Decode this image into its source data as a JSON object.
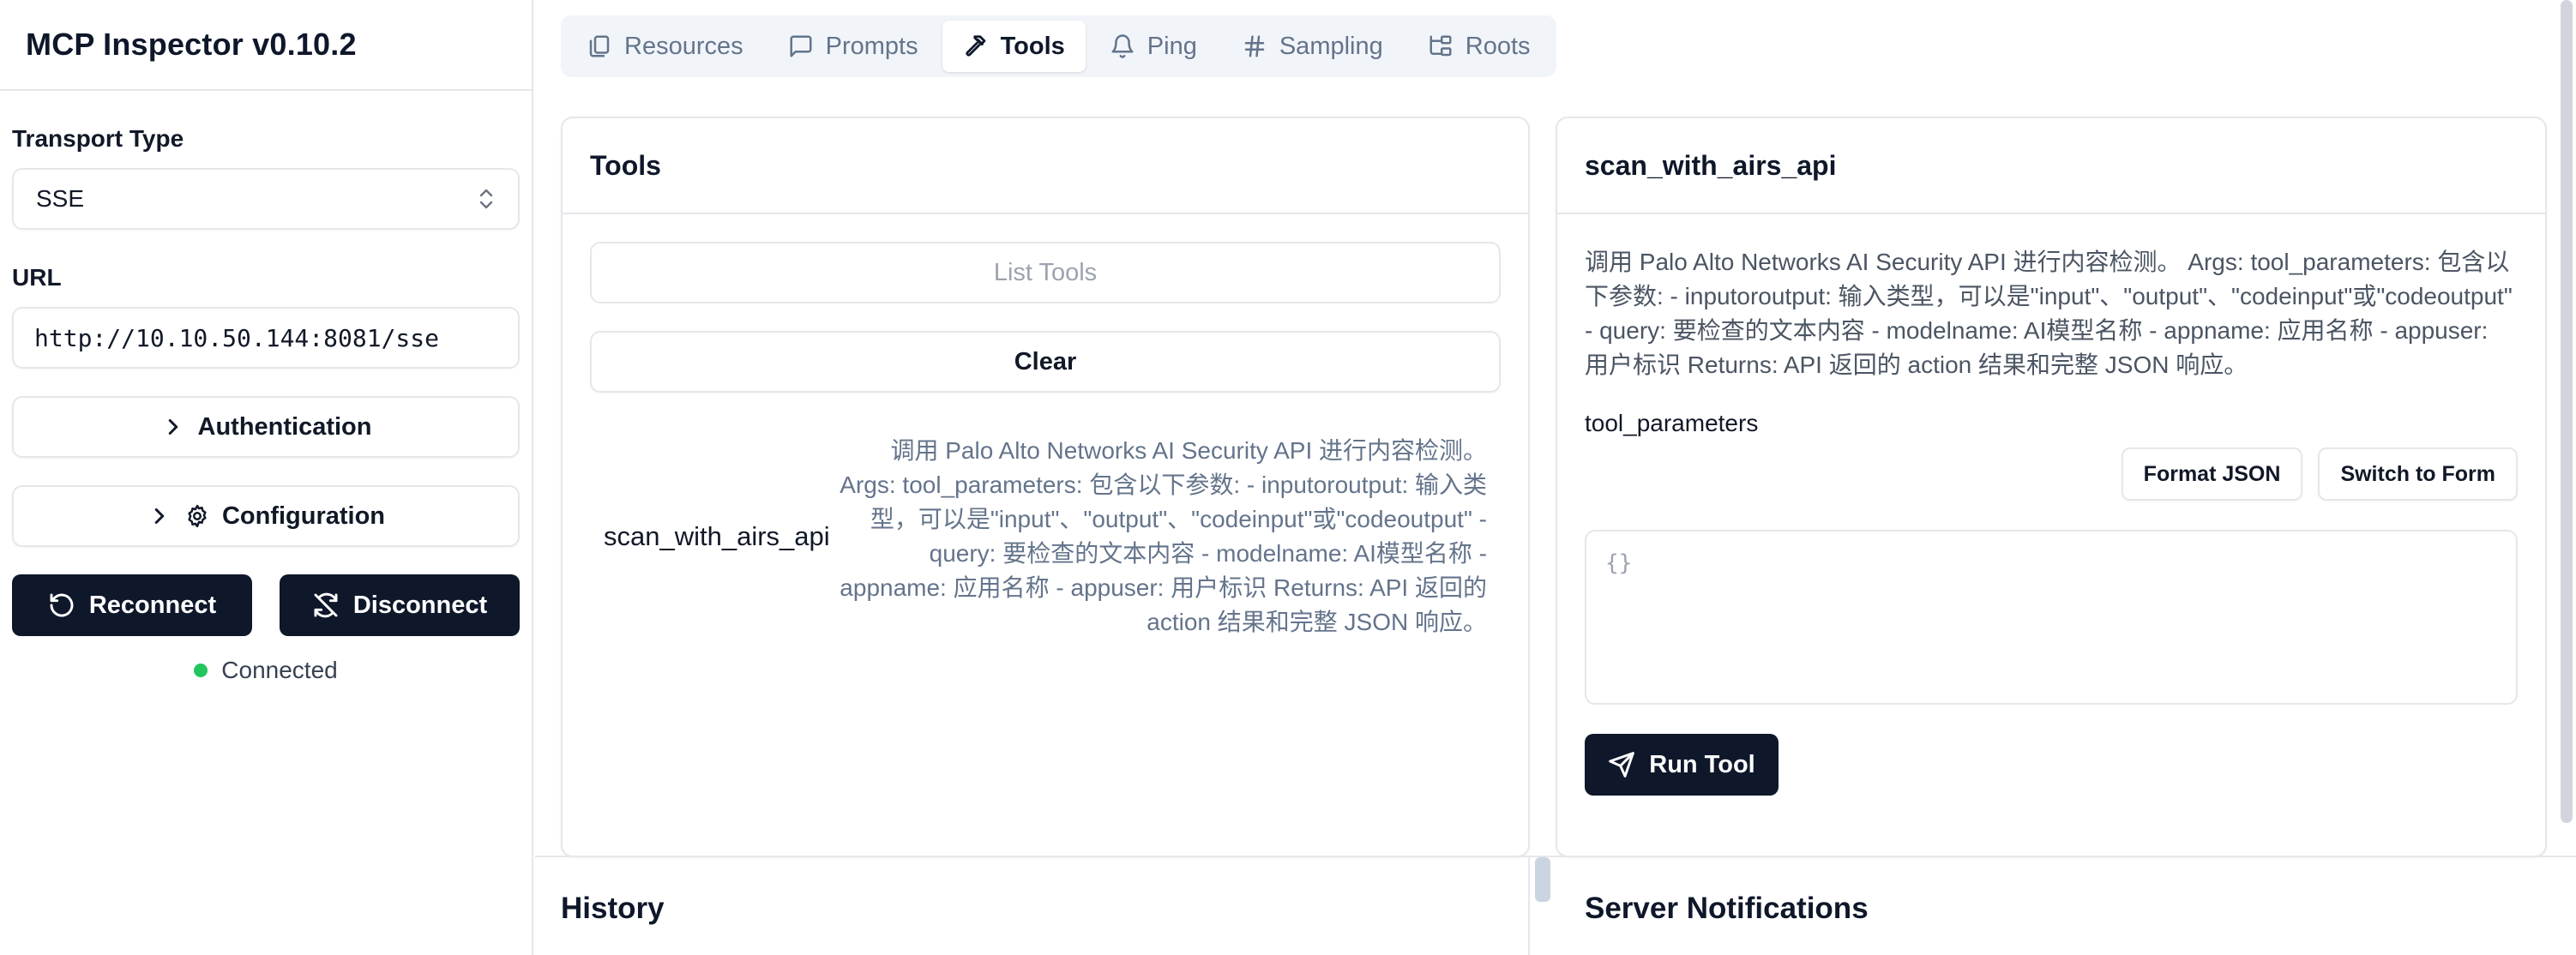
{
  "app": {
    "title": "MCP Inspector v0.10.2"
  },
  "sidebar": {
    "transport_label": "Transport Type",
    "transport_value": "SSE",
    "url_label": "URL",
    "url_value": "http://10.10.50.144:8081/sse",
    "authentication_label": "Authentication",
    "configuration_label": "Configuration",
    "reconnect_label": "Reconnect",
    "disconnect_label": "Disconnect",
    "status_text": "Connected",
    "status_color": "#22c55e"
  },
  "tabs": [
    {
      "label": "Resources",
      "icon": "files-icon"
    },
    {
      "label": "Prompts",
      "icon": "message-square-icon"
    },
    {
      "label": "Tools",
      "icon": "hammer-icon",
      "active": true
    },
    {
      "label": "Ping",
      "icon": "bell-icon"
    },
    {
      "label": "Sampling",
      "icon": "hash-icon"
    },
    {
      "label": "Roots",
      "icon": "folder-tree-icon"
    }
  ],
  "tools_panel": {
    "title": "Tools",
    "list_tools_label": "List Tools",
    "clear_label": "Clear",
    "items": [
      {
        "name": "scan_with_airs_api",
        "description": "调用 Palo Alto Networks AI Security API 进行内容检测。 Args: tool_parameters: 包含以下参数: - inputoroutput: 输入类型，可以是\"input\"、\"output\"、\"codeinput\"或\"codeoutput\" - query: 要检查的文本内容 - modelname: AI模型名称 - appname: 应用名称 - appuser: 用户标识 Returns: API 返回的 action 结果和完整 JSON 响应。"
      }
    ]
  },
  "detail_panel": {
    "title": "scan_with_airs_api",
    "description": "调用 Palo Alto Networks AI Security API 进行内容检测。 Args: tool_parameters: 包含以下参数: - inputoroutput: 输入类型，可以是\"input\"、\"output\"、\"codeinput\"或\"codeoutput\" - query: 要检查的文本内容 - modelname: AI模型名称 - appname: 应用名称 - appuser: 用户标识 Returns: API 返回的 action 结果和完整 JSON 响应。",
    "param_label": "tool_parameters",
    "format_json_label": "Format JSON",
    "switch_form_label": "Switch to Form",
    "json_placeholder": "{}",
    "run_label": "Run Tool"
  },
  "bottom": {
    "history_title": "History",
    "notifications_title": "Server Notifications"
  },
  "colors": {
    "primary_dark": "#0f172a",
    "border": "#e5e7eb",
    "muted_text": "#64748b",
    "tab_bg": "#f1f5f9"
  }
}
